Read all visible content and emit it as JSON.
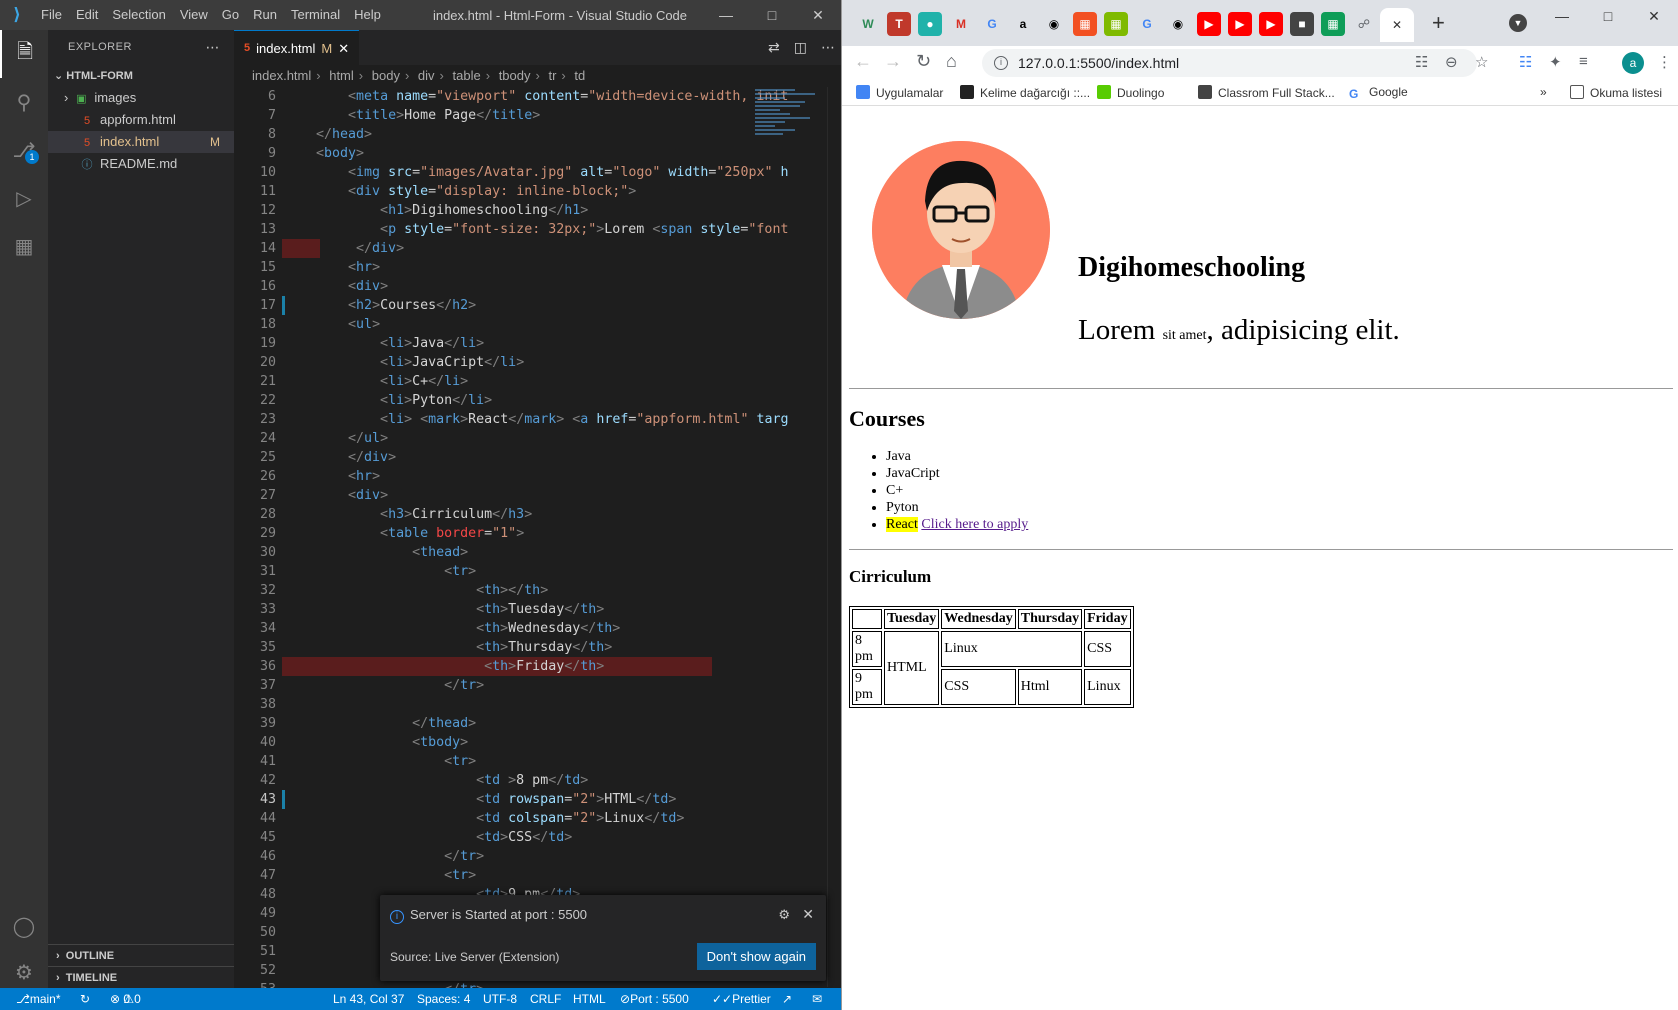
{
  "vscode": {
    "menu": [
      "File",
      "Edit",
      "Selection",
      "View",
      "Go",
      "Run",
      "Terminal",
      "Help"
    ],
    "window_title": "index.html - Html-Form - Visual Studio Code",
    "scm_badge": "1",
    "explorer": {
      "title": "EXPLORER",
      "root": "HTML-FORM",
      "items": [
        {
          "name": "images",
          "type": "folder",
          "modified": ""
        },
        {
          "name": "appform.html",
          "type": "html",
          "modified": ""
        },
        {
          "name": "index.html",
          "type": "html",
          "modified": "M"
        },
        {
          "name": "README.md",
          "type": "info",
          "modified": ""
        }
      ],
      "outline": "OUTLINE",
      "timeline": "TIMELINE"
    },
    "tab": {
      "label": "index.html",
      "modified": "M"
    },
    "breadcrumb": [
      "index.html",
      "html",
      "body",
      "div",
      "table",
      "tbody",
      "tr",
      "td"
    ],
    "code_lines": [
      {
        "n": "6",
        "html": "    <span class='t-br'>&lt;</span><span class='t-tag'>meta</span> <span class='t-attr'>name</span>=<span class='t-str'>\"viewport\"</span> <span class='t-attr'>content</span>=<span class='t-str'>\"width=device-width, init</span>"
      },
      {
        "n": "7",
        "html": "    <span class='t-br'>&lt;</span><span class='t-tag'>title</span><span class='t-br'>&gt;</span><span class='t-txt'>Home Page</span><span class='t-br'>&lt;/</span><span class='t-tag'>title</span><span class='t-br'>&gt;</span>"
      },
      {
        "n": "8",
        "html": "<span class='t-br'>&lt;/</span><span class='t-tag'>head</span><span class='t-br'>&gt;</span>"
      },
      {
        "n": "9",
        "html": "<span class='t-br'>&lt;</span><span class='t-tag'>body</span><span class='t-br'>&gt;</span>"
      },
      {
        "n": "10",
        "html": "    <span class='t-br'>&lt;</span><span class='t-tag'>img</span> <span class='t-attr'>src</span>=<span class='t-str'>\"images/Avatar.jpg\"</span> <span class='t-attr'>alt</span>=<span class='t-str'>\"logo\"</span> <span class='t-attr'>width</span>=<span class='t-str'>\"250px\"</span> <span class='t-attr'>h</span>"
      },
      {
        "n": "11",
        "html": "    <span class='t-br'>&lt;</span><span class='t-tag'>div</span> <span class='t-attr'>style</span>=<span class='t-str'>\"display: inline-block;\"</span><span class='t-br'>&gt;</span>"
      },
      {
        "n": "12",
        "html": "        <span class='t-br'>&lt;</span><span class='t-tag'>h1</span><span class='t-br'>&gt;</span><span class='t-txt'>Digihomeschooling</span><span class='t-br'>&lt;/</span><span class='t-tag'>h1</span><span class='t-br'>&gt;</span>"
      },
      {
        "n": "13",
        "html": "        <span class='t-br'>&lt;</span><span class='t-tag'>p</span> <span class='t-attr'>style</span>=<span class='t-str'>\"font-size: 32px;\"</span><span class='t-br'>&gt;</span><span class='t-txt'>Lorem </span><span class='t-br'>&lt;</span><span class='t-tag'>span</span> <span class='t-attr'>style</span>=<span class='t-str'>\"font</span>"
      },
      {
        "n": "14",
        "html": "     <span class='t-br'>&lt;/</span><span class='t-tag'>div</span><span class='t-br'>&gt;</span>"
      },
      {
        "n": "15",
        "html": "    <span class='t-br'>&lt;</span><span class='t-tag'>hr</span><span class='t-br'>&gt;</span>"
      },
      {
        "n": "16",
        "html": "    <span class='t-br'>&lt;</span><span class='t-tag'>div</span><span class='t-br'>&gt;</span>"
      },
      {
        "n": "17",
        "html": "    <span class='t-br'>&lt;</span><span class='t-tag'>h2</span><span class='t-br'>&gt;</span><span class='t-txt'>Courses</span><span class='t-br'>&lt;/</span><span class='t-tag'>h2</span><span class='t-br'>&gt;</span>"
      },
      {
        "n": "18",
        "html": "    <span class='t-br'>&lt;</span><span class='t-tag'>ul</span><span class='t-br'>&gt;</span>"
      },
      {
        "n": "19",
        "html": "        <span class='t-br'>&lt;</span><span class='t-tag'>li</span><span class='t-br'>&gt;</span><span class='t-txt'>Java</span><span class='t-br'>&lt;/</span><span class='t-tag'>li</span><span class='t-br'>&gt;</span>"
      },
      {
        "n": "20",
        "html": "        <span class='t-br'>&lt;</span><span class='t-tag'>li</span><span class='t-br'>&gt;</span><span class='t-txt'>JavaCript</span><span class='t-br'>&lt;/</span><span class='t-tag'>li</span><span class='t-br'>&gt;</span>"
      },
      {
        "n": "21",
        "html": "        <span class='t-br'>&lt;</span><span class='t-tag'>li</span><span class='t-br'>&gt;</span><span class='t-txt'>C+</span><span class='t-br'>&lt;/</span><span class='t-tag'>li</span><span class='t-br'>&gt;</span>"
      },
      {
        "n": "22",
        "html": "        <span class='t-br'>&lt;</span><span class='t-tag'>li</span><span class='t-br'>&gt;</span><span class='t-txt'>Pyton</span><span class='t-br'>&lt;/</span><span class='t-tag'>li</span><span class='t-br'>&gt;</span>"
      },
      {
        "n": "23",
        "html": "        <span class='t-br'>&lt;</span><span class='t-tag'>li</span><span class='t-br'>&gt;</span> <span class='t-br'>&lt;</span><span class='t-tag'>mark</span><span class='t-br'>&gt;</span><span class='t-txt'>React</span><span class='t-br'>&lt;/</span><span class='t-tag'>mark</span><span class='t-br'>&gt;</span> <span class='t-br'>&lt;</span><span class='t-tag'>a</span> <span class='t-attr'>href</span>=<span class='t-str'>\"appform.html\"</span> <span class='t-attr'>targ</span>"
      },
      {
        "n": "24",
        "html": "    <span class='t-br'>&lt;/</span><span class='t-tag'>ul</span><span class='t-br'>&gt;</span>"
      },
      {
        "n": "25",
        "html": "    <span class='t-br'>&lt;/</span><span class='t-tag'>div</span><span class='t-br'>&gt;</span>"
      },
      {
        "n": "26",
        "html": "    <span class='t-br'>&lt;</span><span class='t-tag'>hr</span><span class='t-br'>&gt;</span>"
      },
      {
        "n": "27",
        "html": "    <span class='t-br'>&lt;</span><span class='t-tag'>div</span><span class='t-br'>&gt;</span>"
      },
      {
        "n": "28",
        "html": "        <span class='t-br'>&lt;</span><span class='t-tag'>h3</span><span class='t-br'>&gt;</span><span class='t-txt'>Cirriculum</span><span class='t-br'>&lt;/</span><span class='t-tag'>h3</span><span class='t-br'>&gt;</span>"
      },
      {
        "n": "29",
        "html": "        <span class='t-br'>&lt;</span><span class='t-tag'>table</span> <span class='t-red'>border</span>=<span class='t-str'>\"1\"</span><span class='t-br'>&gt;</span>"
      },
      {
        "n": "30",
        "html": "            <span class='t-br'>&lt;</span><span class='t-tag'>thead</span><span class='t-br'>&gt;</span>"
      },
      {
        "n": "31",
        "html": "                <span class='t-br'>&lt;</span><span class='t-tag'>tr</span><span class='t-br'>&gt;</span>"
      },
      {
        "n": "32",
        "html": "                    <span class='t-br'>&lt;</span><span class='t-tag'>th</span><span class='t-br'>&gt;&lt;/</span><span class='t-tag'>th</span><span class='t-br'>&gt;</span>"
      },
      {
        "n": "33",
        "html": "                    <span class='t-br'>&lt;</span><span class='t-tag'>th</span><span class='t-br'>&gt;</span><span class='t-txt'>Tuesday</span><span class='t-br'>&lt;/</span><span class='t-tag'>th</span><span class='t-br'>&gt;</span>"
      },
      {
        "n": "34",
        "html": "                    <span class='t-br'>&lt;</span><span class='t-tag'>th</span><span class='t-br'>&gt;</span><span class='t-txt'>Wednesday</span><span class='t-br'>&lt;/</span><span class='t-tag'>th</span><span class='t-br'>&gt;</span>"
      },
      {
        "n": "35",
        "html": "                    <span class='t-br'>&lt;</span><span class='t-tag'>th</span><span class='t-br'>&gt;</span><span class='t-txt'>Thursday</span><span class='t-br'>&lt;/</span><span class='t-tag'>th</span><span class='t-br'>&gt;</span>"
      },
      {
        "n": "36",
        "html": "                     <span class='t-br'>&lt;</span><span class='t-tag'>th</span><span class='t-br'>&gt;</span><span class='t-txt'>Friday</span><span class='t-br'>&lt;/</span><span class='t-tag'>th</span><span class='t-br'>&gt;</span>"
      },
      {
        "n": "37",
        "html": "                <span class='t-br'>&lt;/</span><span class='t-tag'>tr</span><span class='t-br'>&gt;</span>"
      },
      {
        "n": "38",
        "html": ""
      },
      {
        "n": "39",
        "html": "            <span class='t-br'>&lt;/</span><span class='t-tag'>thead</span><span class='t-br'>&gt;</span>"
      },
      {
        "n": "40",
        "html": "            <span class='t-br'>&lt;</span><span class='t-tag'>tbody</span><span class='t-br'>&gt;</span>"
      },
      {
        "n": "41",
        "html": "                <span class='t-br'>&lt;</span><span class='t-tag'>tr</span><span class='t-br'>&gt;</span>"
      },
      {
        "n": "42",
        "html": "                    <span class='t-br'>&lt;</span><span class='t-tag'>td</span> <span class='t-br'>&gt;</span><span class='t-txt'>8 pm</span><span class='t-br'>&lt;/</span><span class='t-tag'>td</span><span class='t-br'>&gt;</span>"
      },
      {
        "n": "43",
        "html": "                    <span class='t-br'>&lt;</span><span class='t-tag'>td</span> <span class='t-attr'>rowspan</span>=<span class='t-str'>\"2\"</span><span class='t-br'>&gt;</span><span class='t-txt'>HTML</span><span class='t-br'>&lt;/</span><span class='t-tag'>td</span><span class='t-br'>&gt;</span>"
      },
      {
        "n": "44",
        "html": "                    <span class='t-br'>&lt;</span><span class='t-tag'>td</span> <span class='t-attr'>colspan</span>=<span class='t-str'>\"2\"</span><span class='t-br'>&gt;</span><span class='t-txt'>Linux</span><span class='t-br'>&lt;/</span><span class='t-tag'>td</span><span class='t-br'>&gt;</span>"
      },
      {
        "n": "45",
        "html": "                    <span class='t-br'>&lt;</span><span class='t-tag'>td</span><span class='t-br'>&gt;</span><span class='t-txt'>CSS</span><span class='t-br'>&lt;/</span><span class='t-tag'>td</span><span class='t-br'>&gt;</span>"
      },
      {
        "n": "46",
        "html": "                <span class='t-br'>&lt;/</span><span class='t-tag'>tr</span><span class='t-br'>&gt;</span>"
      },
      {
        "n": "47",
        "html": "                <span class='t-br'>&lt;</span><span class='t-tag'>tr</span><span class='t-br'>&gt;</span>"
      },
      {
        "n": "48",
        "html": "                    <span class='t-br'>&lt;</span><span class='t-tag'>td</span><span class='t-br'>&gt;</span><span class='t-txt'>9 pm</span><span class='t-br'>&lt;/</span><span class='t-tag'>td</span><span class='t-br'>&gt;</span>"
      },
      {
        "n": "49",
        "html": ""
      },
      {
        "n": "50",
        "html": ""
      },
      {
        "n": "51",
        "html": ""
      },
      {
        "n": "52",
        "html": ""
      },
      {
        "n": "53",
        "html": "                <span class='t-br'>&lt;/</span><span class='t-tag'>tr</span><span class='t-br'>&gt;</span>"
      }
    ],
    "notification": {
      "message": "Server is Started at port : 5500",
      "source": "Source: Live Server (Extension)",
      "button": "Don't show again"
    },
    "status": {
      "branch": "main*",
      "errors": "0",
      "warnings": "0",
      "position": "Ln 43, Col 37",
      "spaces": "Spaces: 4",
      "encoding": "UTF-8",
      "eol": "CRLF",
      "language": "HTML",
      "port": "Port : 5500",
      "prettier": "Prettier"
    }
  },
  "chrome": {
    "url": "127.0.0.1:5500/index.html",
    "bookmarks": [
      "Uygulamalar",
      "Kelime dağarcığı ::...",
      "Duolingo",
      "Classrom Full Stack...",
      "Google"
    ],
    "reading_list": "Okuma listesi",
    "profile_initial": "a",
    "page": {
      "h1": "Digihomeschooling",
      "lead_big": "Lorem ",
      "lead_small": "sit amet",
      "lead_rest": ", adipisicing elit.",
      "h2": "Courses",
      "courses": [
        "Java",
        "JavaCript",
        "C+",
        "Pyton"
      ],
      "react_mark": "React",
      "apply_link": "Click here to apply",
      "h3": "Cirriculum",
      "table": {
        "headers": [
          "",
          "Tuesday",
          "Wednesday",
          "Thursday",
          "Friday"
        ],
        "r1_time": "8 pm",
        "r1_html": "HTML",
        "r1_linux": "Linux",
        "r1_css": "CSS",
        "r2_time": "9 pm",
        "r2_css": "CSS",
        "r2_html": "Html",
        "r2_linux": "Linux"
      }
    }
  }
}
